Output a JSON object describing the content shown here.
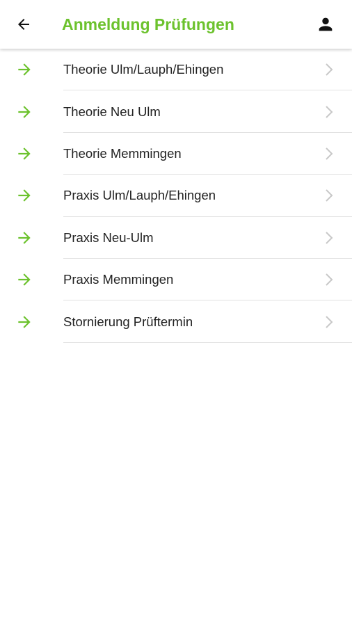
{
  "colors": {
    "accent": "#6cc22d",
    "text": "#222222",
    "chevron": "#c8c8c8",
    "divider": "#e2e2e2"
  },
  "header": {
    "title": "Anmeldung Prüfungen",
    "back_icon": "arrow-back-icon",
    "account_icon": "person-icon"
  },
  "list": {
    "items": [
      {
        "label": "Theorie Ulm/Lauph/Ehingen"
      },
      {
        "label": "Theorie Neu Ulm"
      },
      {
        "label": "Theorie Memmingen"
      },
      {
        "label": "Praxis Ulm/Lauph/Ehingen"
      },
      {
        "label": "Praxis Neu-Ulm"
      },
      {
        "label": "Praxis Memmingen"
      },
      {
        "label": "Stornierung Prüftermin"
      }
    ]
  }
}
